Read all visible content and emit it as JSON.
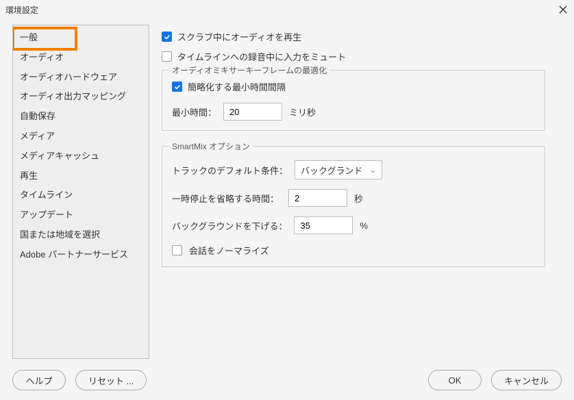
{
  "title": "環境設定",
  "sidebar": {
    "items": [
      {
        "label": "一般"
      },
      {
        "label": "オーディオ"
      },
      {
        "label": "オーディオハードウェア"
      },
      {
        "label": "オーディオ出力マッピング"
      },
      {
        "label": "自動保存"
      },
      {
        "label": "メディア"
      },
      {
        "label": "メディアキャッシュ"
      },
      {
        "label": "再生"
      },
      {
        "label": "タイムライン"
      },
      {
        "label": "アップデート"
      },
      {
        "label": "国または地域を選択"
      },
      {
        "label": "Adobe パートナーサービス"
      }
    ],
    "selected_index": 1
  },
  "main": {
    "scrub_audio": {
      "checked": true,
      "label": "スクラブ中にオーディオを再生"
    },
    "mute_input": {
      "checked": false,
      "label": "タイムラインへの録音中に入力をミュート"
    },
    "mixer_group": {
      "legend": "オーディオミキサーキーフレームの最適化",
      "reduce": {
        "checked": true,
        "label": "簡略化する最小時間間隔"
      },
      "min_time_label": "最小時間：",
      "min_time_value": "20",
      "min_time_unit": "ミリ秒"
    },
    "smartmix_group": {
      "legend": "SmartMix オプション",
      "track_default_label": "トラックのデフォルト条件：",
      "track_default_value": "バックグランド",
      "pause_label": "一時停止を省略する時間：",
      "pause_value": "2",
      "pause_unit": "秒",
      "bg_down_label": "バックグラウンドを下げる：",
      "bg_down_value": "35",
      "bg_down_unit": "%",
      "normalize": {
        "checked": false,
        "label": "会話をノーマライズ"
      }
    }
  },
  "footer": {
    "help": "ヘルプ",
    "reset": "リセット ...",
    "ok": "OK",
    "cancel": "キャンセル"
  }
}
